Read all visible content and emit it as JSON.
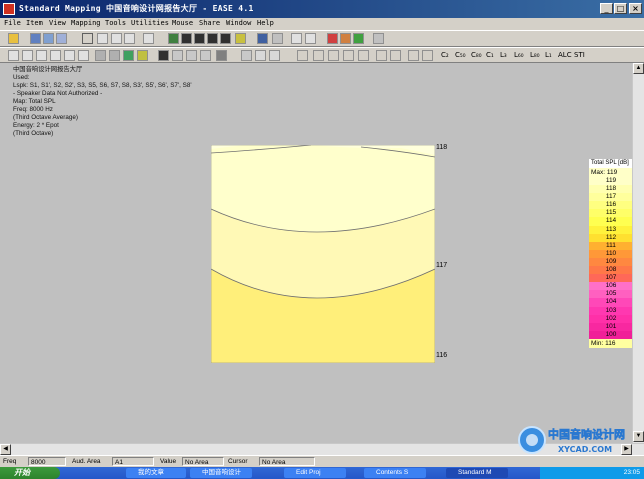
{
  "window": {
    "title": "Standard Mapping 中国音响设计网报告大厅 - EASE 4.1",
    "controls": [
      "_",
      "□",
      "×"
    ]
  },
  "menu": [
    "File",
    "Item",
    "View",
    "Mapping",
    "Tools",
    "Utilities",
    "Mouse",
    "Share",
    "Window",
    "Help"
  ],
  "toolbar2_text": {
    "c1": "C₂",
    "c2": "C₅₀",
    "c3": "C₈₀",
    "c4": "C₁",
    "l1": "L₃",
    "l2": "L₆₀",
    "l3": "L₈₀",
    "l4": "L₁",
    "alc": "ALC",
    "sti": "STI"
  },
  "info_lines": [
    "中国音响设计网报告大厅",
    "Used:",
    "Lspk: S1, S1', S2, S2', S3, S5, S6, S7, S8, S3', S5', S6', S7', S8'",
    "- Speaker Data Not Authorized -",
    "Map: Total SPL",
    "Freq: 8000 Hz",
    "(Third Octave Average)",
    "Energy: 2 * Epot",
    "(Third Octave)"
  ],
  "contour_labels": {
    "top": "118",
    "middle": "117",
    "bottom": "116"
  },
  "legend": {
    "title": "Total SPL [dB]",
    "max_label": "Max: 119",
    "min_label": "Min: 116",
    "scale": [
      {
        "value": "119",
        "color": "#ffffc8"
      },
      {
        "value": "118",
        "color": "#ffffb0"
      },
      {
        "value": "117",
        "color": "#ffff9c"
      },
      {
        "value": "116",
        "color": "#ffff80"
      },
      {
        "value": "115",
        "color": "#ffff68"
      },
      {
        "value": "114",
        "color": "#ffff50"
      },
      {
        "value": "113",
        "color": "#fff23c"
      },
      {
        "value": "112",
        "color": "#ffe030"
      },
      {
        "value": "111",
        "color": "#ffb030"
      },
      {
        "value": "110",
        "color": "#ff9838"
      },
      {
        "value": "109",
        "color": "#ff8840"
      },
      {
        "value": "108",
        "color": "#ff7848"
      },
      {
        "value": "107",
        "color": "#ff6858"
      },
      {
        "value": "106",
        "color": "#ff70c8"
      },
      {
        "value": "105",
        "color": "#ff60c0"
      },
      {
        "value": "104",
        "color": "#ff48b8"
      },
      {
        "value": "103",
        "color": "#ff38b0"
      },
      {
        "value": "102",
        "color": "#ff30a8"
      },
      {
        "value": "101",
        "color": "#f828a0"
      },
      {
        "value": "100",
        "color": "#f02098"
      }
    ]
  },
  "status": {
    "freq_label": "Freq",
    "freq_value": "8000",
    "aud_label": "Aud. Area",
    "aud_value": "A1",
    "value_label": "Value",
    "value_value": "No Area",
    "cursor_label": "Cursor",
    "cursor_value": "No Area"
  },
  "taskbar": {
    "start": "开始",
    "items": [
      "我的文章",
      "中国音响设计",
      "Edit Proj",
      "Contents S",
      "Standard M"
    ],
    "clock": "23:05"
  },
  "watermark": {
    "text": "中国音响设计网",
    "url": "XYCAD.COM"
  }
}
